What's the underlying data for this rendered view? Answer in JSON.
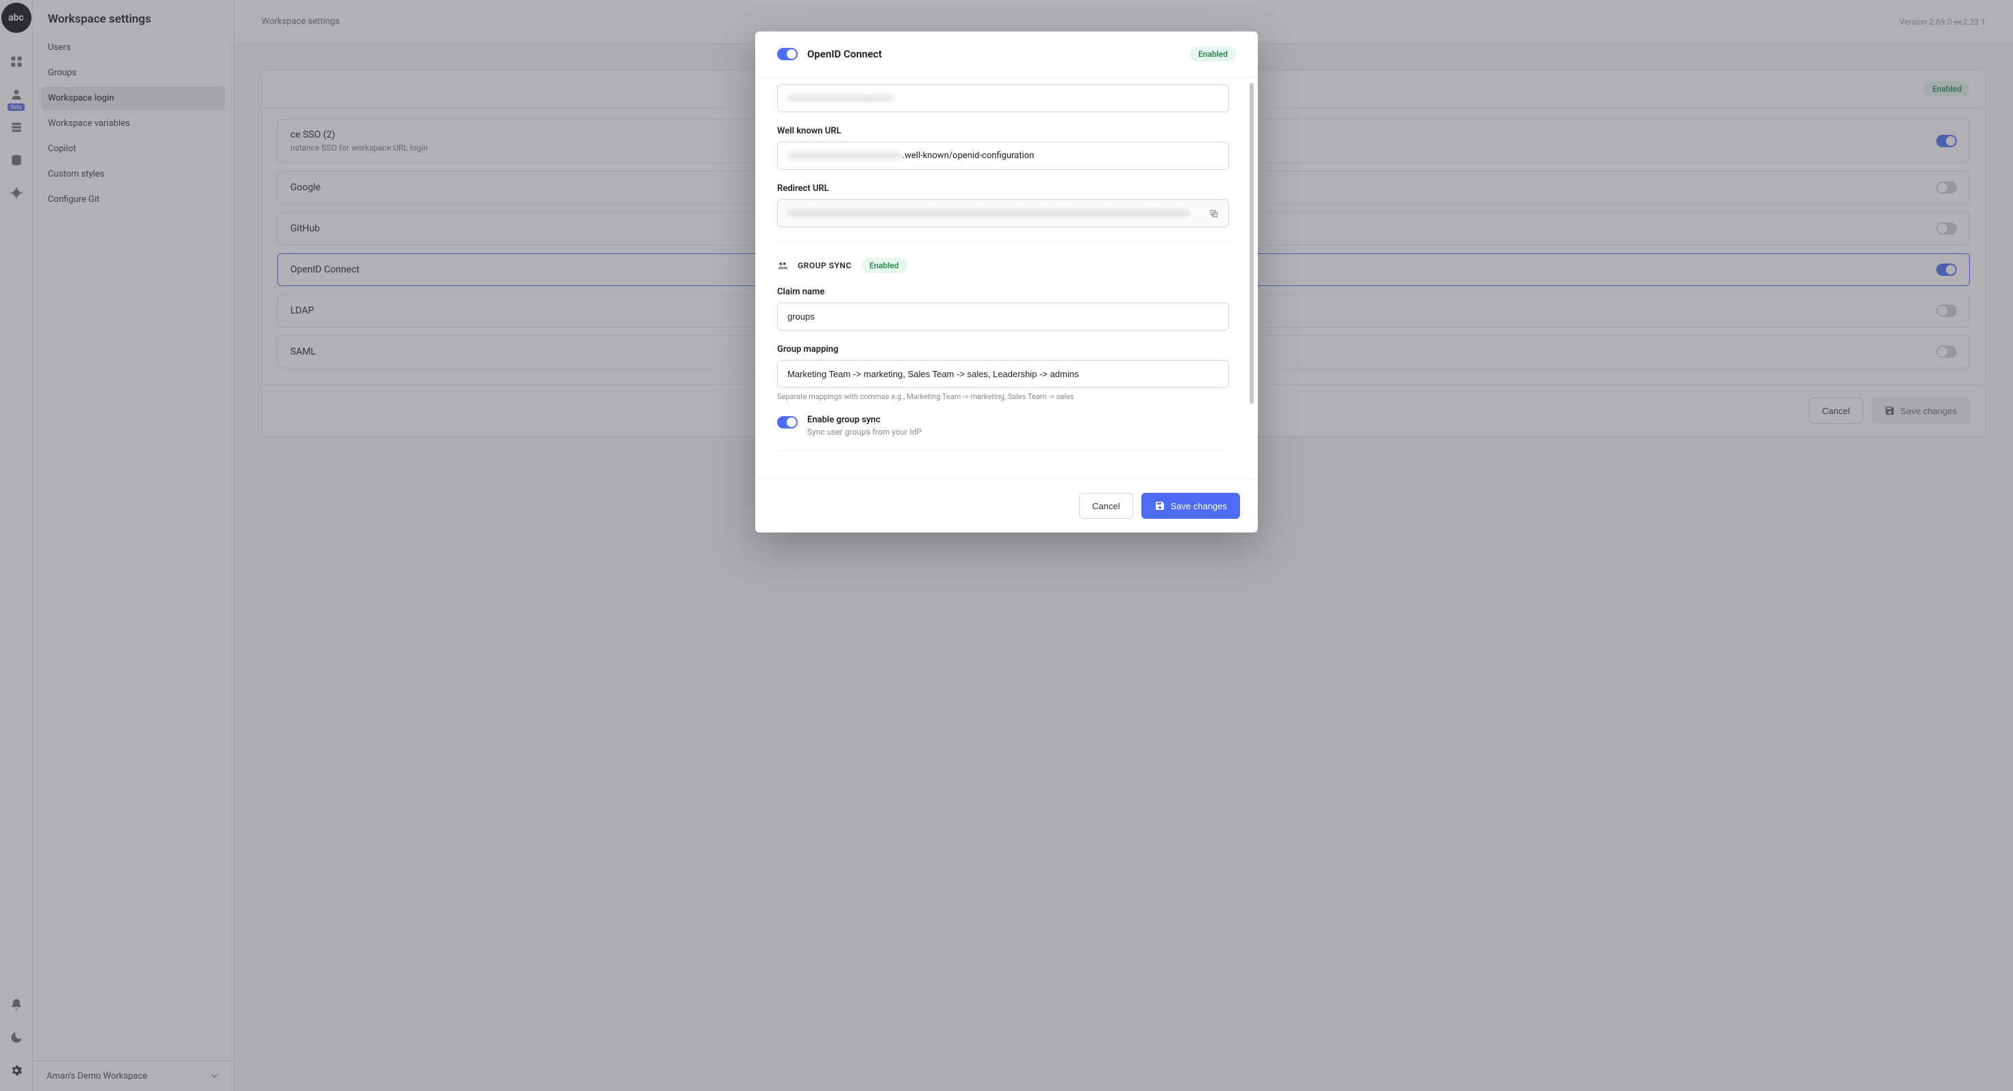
{
  "logo_text": "abc",
  "version": "Version 2.69.0-ee2.23.1",
  "breadcrumb": "Workspace settings",
  "sidebar": {
    "title": "Workspace settings",
    "items": [
      {
        "label": "Users"
      },
      {
        "label": "Groups"
      },
      {
        "label": "Workspace login"
      },
      {
        "label": "Workspace variables"
      },
      {
        "label": "Copilot"
      },
      {
        "label": "Custom styles"
      },
      {
        "label": "Configure Git"
      }
    ],
    "workspace_name": "Aman's Demo Workspace"
  },
  "sso_card": {
    "enabled_badge": "Enabled",
    "rows": [
      {
        "title_suffix": "ce SSO (2)",
        "sub_suffix": "nstance SSO for workspace URL login",
        "on": true
      },
      {
        "title": "Google",
        "on": false
      },
      {
        "title": "GitHub",
        "on": false
      },
      {
        "title": "OpenID Connect",
        "on": true
      },
      {
        "title": "LDAP",
        "on": false
      },
      {
        "title": "SAML",
        "on": false
      }
    ],
    "cancel": "Cancel",
    "save": "Save changes"
  },
  "modal": {
    "title": "OpenID Connect",
    "enabled_badge": "Enabled",
    "well_known_label": "Well known URL",
    "well_known_suffix": ".well-known/openid-configuration",
    "redirect_label": "Redirect URL",
    "group_sync_title": "GROUP SYNC",
    "group_sync_badge": "Enabled",
    "claim_label": "Claim name",
    "claim_value": "groups",
    "mapping_label": "Group mapping",
    "mapping_value": "Marketing Team -> marketing, Sales Team -> sales, Leadership -> admins",
    "mapping_help": "Separate mappings with commas e.g., Marketing Team -> marketing, Sales Team -> sales",
    "toggle_title": "Enable group sync",
    "toggle_sub": "Sync user groups from your IdP",
    "cancel": "Cancel",
    "save": "Save changes"
  }
}
